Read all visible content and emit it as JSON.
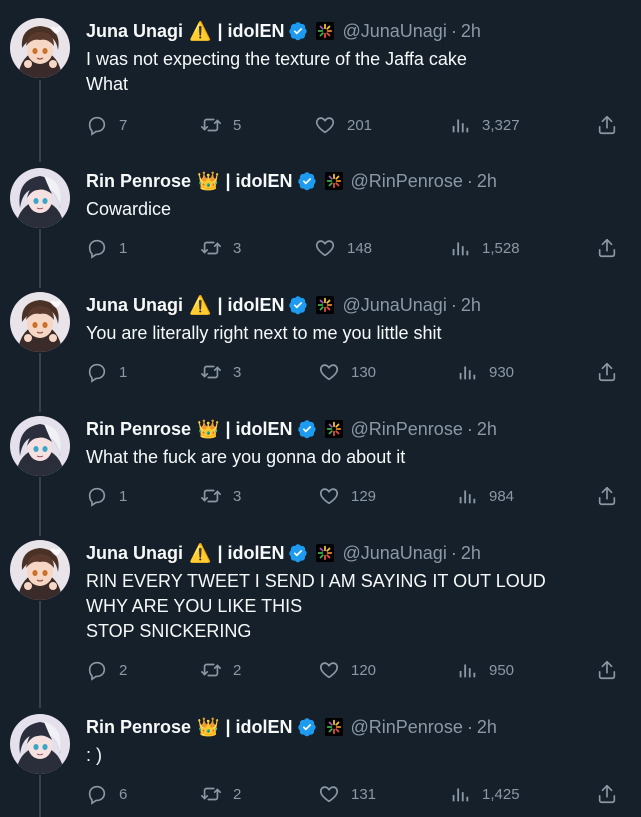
{
  "colors": {
    "background": "#15202b",
    "text": "#f7f9f9",
    "muted": "#8b98a5",
    "verified": "#1d9bf0",
    "thread_line": "#38444d"
  },
  "tweets": [
    {
      "author": "juna",
      "name": "Juna Unagi",
      "emoji": "⚠️",
      "affiliation": "| idolEN",
      "handle": "@JunaUnagi",
      "time": "2h",
      "text": "I was not expecting the texture of the Jaffa cake\nWhat",
      "replies": "7",
      "retweets": "5",
      "likes": "201",
      "views": "3,327"
    },
    {
      "author": "rin",
      "name": "Rin Penrose",
      "emoji": "👑",
      "affiliation": "| idolEN",
      "handle": "@RinPenrose",
      "time": "2h",
      "text": "Cowardice",
      "replies": "1",
      "retweets": "3",
      "likes": "148",
      "views": "1,528"
    },
    {
      "author": "juna",
      "name": "Juna Unagi",
      "emoji": "⚠️",
      "affiliation": "| idolEN",
      "handle": "@JunaUnagi",
      "time": "2h",
      "text": "You are literally right next to me you little shit",
      "replies": "1",
      "retweets": "3",
      "likes": "130",
      "views": "930"
    },
    {
      "author": "rin",
      "name": "Rin Penrose",
      "emoji": "👑",
      "affiliation": "| idolEN",
      "handle": "@RinPenrose",
      "time": "2h",
      "text": "What the fuck are you gonna do about it",
      "replies": "1",
      "retweets": "3",
      "likes": "129",
      "views": "984"
    },
    {
      "author": "juna",
      "name": "Juna Unagi",
      "emoji": "⚠️",
      "affiliation": "| idolEN",
      "handle": "@JunaUnagi",
      "time": "2h",
      "text": "RIN EVERY TWEET I SEND I AM SAYING IT OUT LOUD\nWHY ARE YOU LIKE THIS\nSTOP SNICKERING",
      "replies": "2",
      "retweets": "2",
      "likes": "120",
      "views": "950"
    },
    {
      "author": "rin",
      "name": "Rin Penrose",
      "emoji": "👑",
      "affiliation": "| idolEN",
      "handle": "@RinPenrose",
      "time": "2h",
      "text": ": )",
      "replies": "6",
      "retweets": "2",
      "likes": "131",
      "views": "1,425"
    }
  ]
}
